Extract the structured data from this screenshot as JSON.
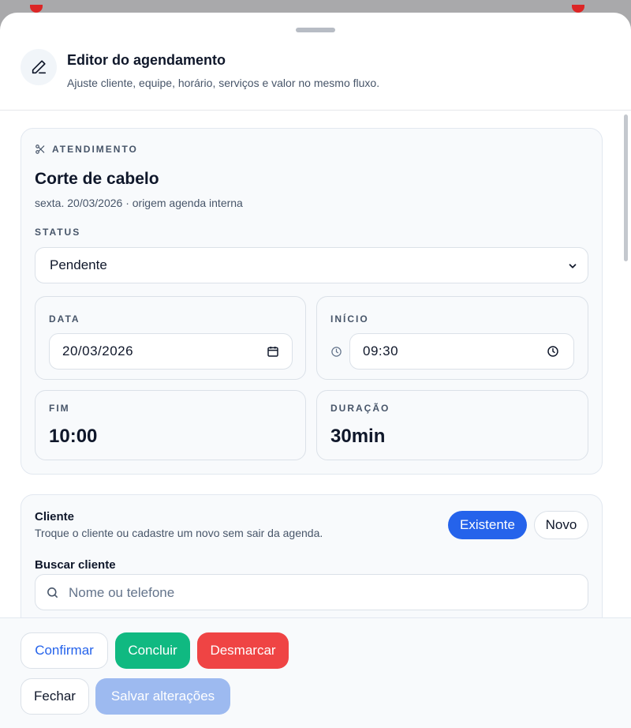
{
  "header": {
    "title": "Editor do agendamento",
    "subtitle": "Ajuste cliente, equipe, horário, serviços e valor no mesmo fluxo."
  },
  "appointment": {
    "section_label": "ATENDIMENTO",
    "title": "Corte de cabelo",
    "subtitle": "sexta. 20/03/2026 · origem agenda interna",
    "status_label": "STATUS",
    "status_value": "Pendente",
    "date_label": "DATA",
    "date_value": "20/03/2026",
    "start_label": "INÍCIO",
    "start_value": "09:30",
    "end_label": "FIM",
    "end_value": "10:00",
    "duration_label": "DURAÇÃO",
    "duration_value": "30min"
  },
  "client": {
    "title": "Cliente",
    "subtitle": "Troque o cliente ou cadastre um novo sem sair da agenda.",
    "toggle_existing": "Existente",
    "toggle_new": "Novo",
    "search_label": "Buscar cliente",
    "search_placeholder": "Nome ou telefone"
  },
  "footer": {
    "confirm": "Confirmar",
    "complete": "Concluir",
    "unschedule": "Desmarcar",
    "close": "Fechar",
    "save": "Salvar alterações"
  },
  "colors": {
    "accent": "#2563eb",
    "success": "#10b981",
    "danger": "#ef4444",
    "disabled": "#9dbaf0"
  }
}
